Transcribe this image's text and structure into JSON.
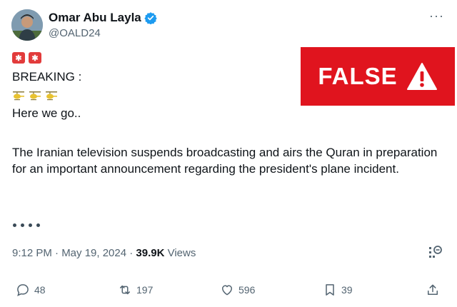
{
  "author": {
    "name": "Omar Abu Layla",
    "handle": "@OALD24",
    "avatar_icon": "profile-photo"
  },
  "menu_icon": "more-options-icon",
  "tweet": {
    "line_breaking": "BREAKING :",
    "line_here": "Here we go..",
    "body": "The Iranian television suspends broadcasting and airs the Quran in preparation for an important announcement regarding the president's plane incident.",
    "emoji_sirens": [
      "siren-icon",
      "siren-icon"
    ],
    "emoji_helicopters": [
      "helicopter-icon",
      "helicopter-icon",
      "helicopter-icon"
    ]
  },
  "meta": {
    "timestamp": "9:12 PM · May 19, 2024 · ",
    "views_count": "39.9K",
    "views_label": " Views"
  },
  "actions": {
    "replies": "48",
    "reposts": "197",
    "likes": "596",
    "bookmarks": "39"
  },
  "fact_check": {
    "label": "FALSE",
    "color": "#e0141e"
  },
  "colors": {
    "verified": "#1d9bf0",
    "secondary_text": "#536471"
  }
}
